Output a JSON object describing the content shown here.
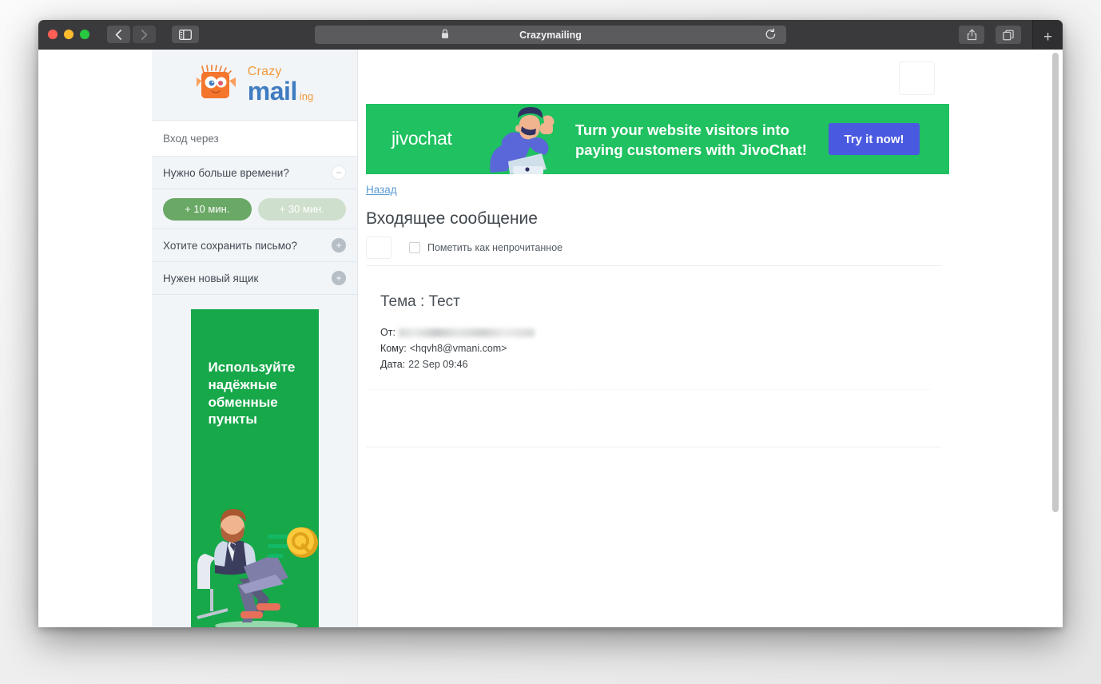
{
  "browser": {
    "title": "Crazymailing",
    "lock_icon": "lock-icon",
    "reload_icon": "reload-icon",
    "back_icon": "chevron-left-icon",
    "forward_icon": "chevron-right-icon",
    "sidebar_icon": "sidebar-toggle-icon",
    "share_icon": "share-icon",
    "tabs_icon": "show-tabs-icon",
    "newtab_label": "+",
    "traffic_lights": [
      "close",
      "minimize",
      "zoom"
    ]
  },
  "sidebar": {
    "logo": {
      "crazy": "Crazy",
      "mail": "mail",
      "ing": "ing"
    },
    "login_row": {
      "label": "Вход через"
    },
    "rows": [
      {
        "label": "Нужно больше времени?",
        "badge": "−",
        "badge_type": "minus"
      },
      {
        "label": "Хотите сохранить письмо?",
        "badge": "+",
        "badge_type": "plus"
      },
      {
        "label": "Нужен новый ящик",
        "badge": "+",
        "badge_type": "plus"
      }
    ],
    "time_buttons": [
      {
        "label": "+ 10 мин.",
        "state": "active"
      },
      {
        "label": "+ 30 мин.",
        "state": "inactive"
      }
    ],
    "ad": {
      "title": "Используйте надёжные обменные пункты",
      "bg_color": "#17a84a"
    }
  },
  "banner": {
    "brand": "jivochat",
    "headline": "Turn your website visitors into paying customers with JivoChat!",
    "cta": "Try it now!",
    "bg_color": "#1fc160",
    "cta_color": "#4a5ae0"
  },
  "main": {
    "back_link": "Назад",
    "page_title": "Входящее сообщение",
    "mark_unread_label": "Пометить как непрочитанное",
    "message": {
      "subject": "Тема : Тест",
      "from_key": "От:",
      "from_value": "",
      "to_key": "Кому:",
      "to_value": "<hqvh8@vmani.com>",
      "date_key": "Дата:",
      "date_value": "22 Sep 09:46"
    }
  }
}
